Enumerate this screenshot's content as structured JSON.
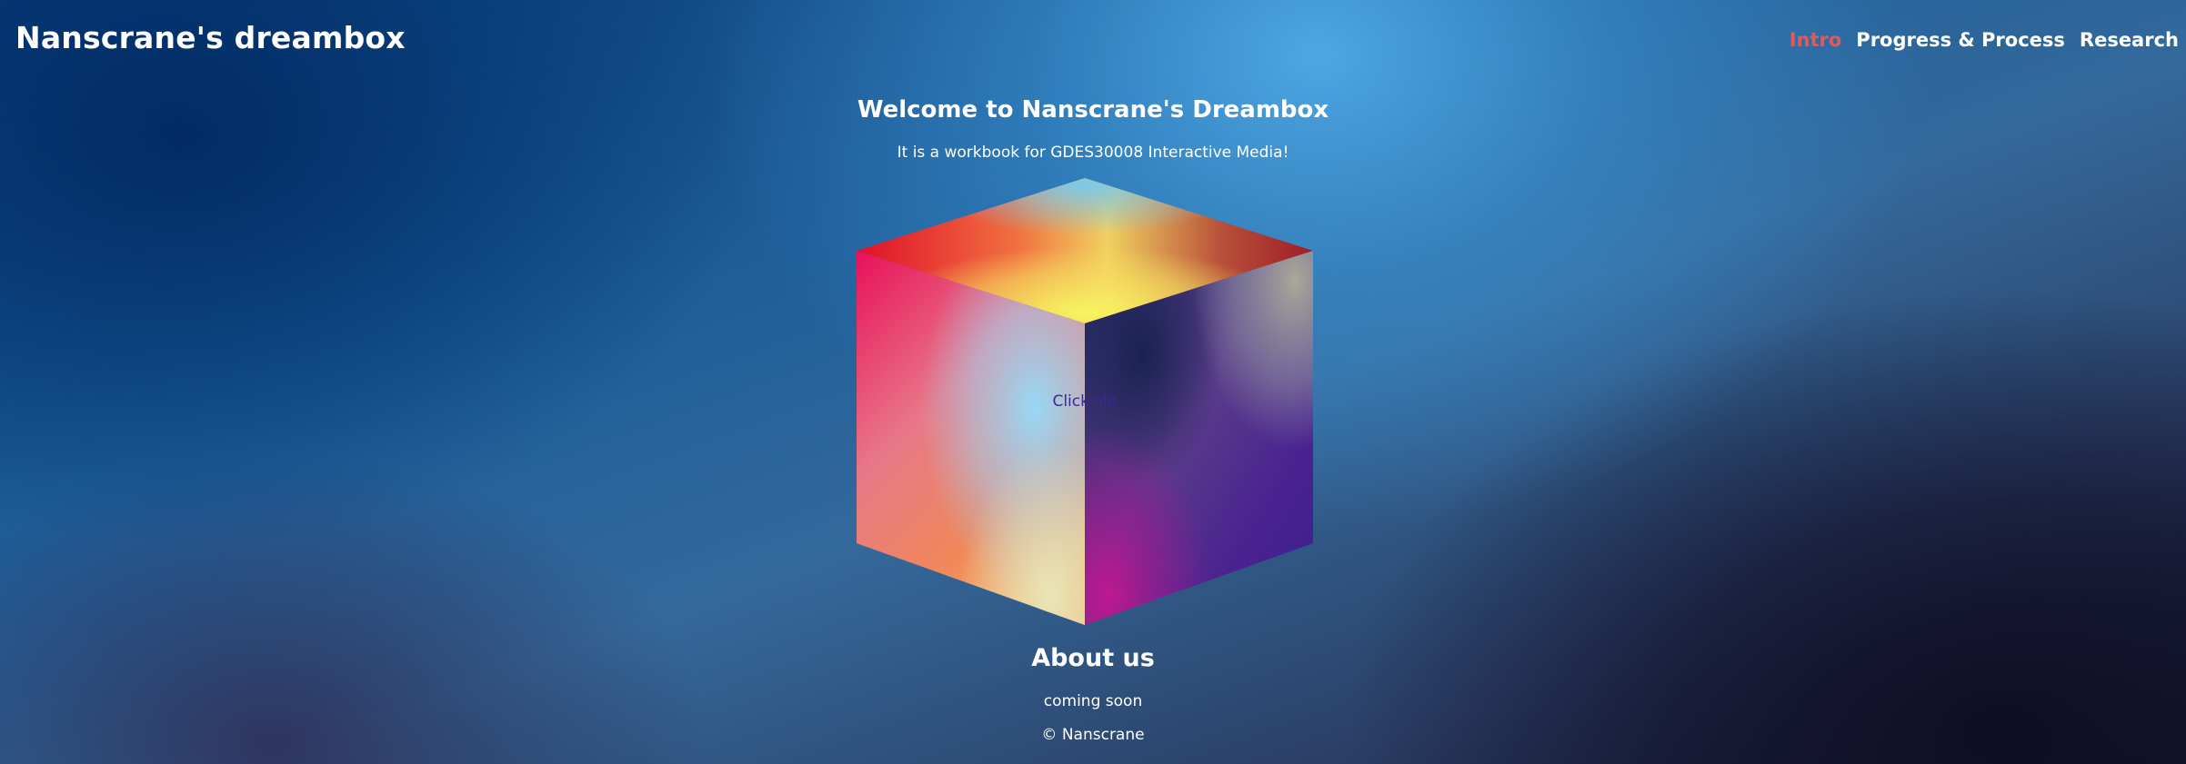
{
  "header": {
    "site_title": "Nanscrane's dreambox"
  },
  "nav": {
    "items": [
      {
        "label": "Intro",
        "active": true
      },
      {
        "label": "Progress & Process",
        "active": false
      },
      {
        "label": "Research",
        "active": false
      }
    ],
    "active_color": "#e05a5a"
  },
  "intro": {
    "welcome": "Welcome to Nanscrane's Dreambox",
    "subtitle": "It is a workbook for GDES30008 Interactive Media!"
  },
  "cube": {
    "label": "Click Me"
  },
  "about": {
    "title": "About us",
    "text": "coming soon"
  },
  "footer": {
    "copyright": "© Nanscrane"
  }
}
